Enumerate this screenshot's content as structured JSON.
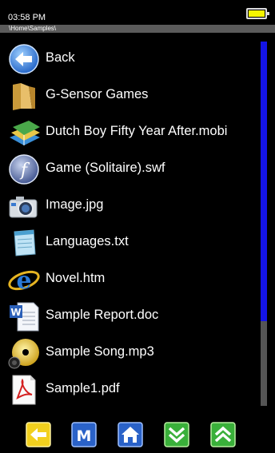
{
  "status": {
    "time": "03:58 PM"
  },
  "path": "\\Home\\Samples\\",
  "files": [
    {
      "label": "Back",
      "icon": "back-arrow-icon"
    },
    {
      "label": "G-Sensor Games",
      "icon": "folder-icon"
    },
    {
      "label": "Dutch Boy Fifty Year After.mobi",
      "icon": "ebook-stack-icon"
    },
    {
      "label": "Game (Solitaire).swf",
      "icon": "flash-icon"
    },
    {
      "label": "Image.jpg",
      "icon": "camera-icon"
    },
    {
      "label": "Languages.txt",
      "icon": "notepad-icon"
    },
    {
      "label": "Novel.htm",
      "icon": "internet-explorer-icon"
    },
    {
      "label": "Sample Report.doc",
      "icon": "word-document-icon"
    },
    {
      "label": "Sample Song.mp3",
      "icon": "music-disc-icon"
    },
    {
      "label": "Sample1.pdf",
      "icon": "pdf-icon"
    }
  ],
  "toolbar": {
    "menu_label": "M",
    "icons": [
      "back-button-icon",
      "menu-button-icon",
      "home-button-icon",
      "page-down-button-icon",
      "page-up-button-icon"
    ]
  },
  "colors": {
    "scroll_thumb": "#1414e6",
    "battery": "#f5f500"
  }
}
